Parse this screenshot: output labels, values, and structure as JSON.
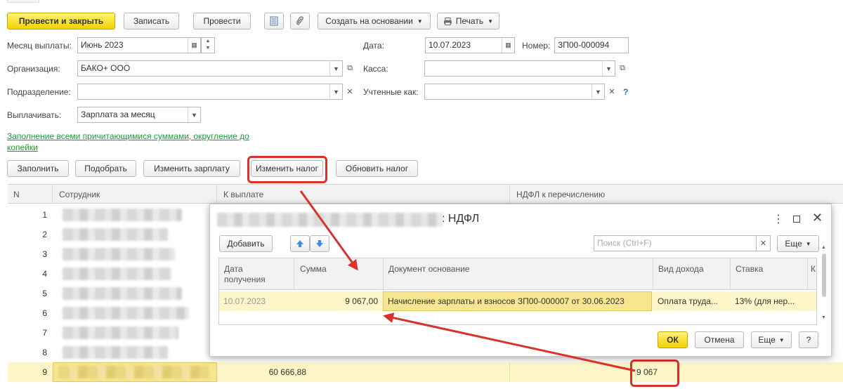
{
  "toolbar": {
    "post_close": "Провести и закрыть",
    "save": "Записать",
    "post": "Провести",
    "create_based": "Создать на основании",
    "print": "Печать"
  },
  "form": {
    "month_label": "Месяц выплаты:",
    "month_value": "Июнь 2023",
    "date_label": "Дата:",
    "date_value": "10.07.2023",
    "number_label": "Номер:",
    "number_value": "ЗП00-000094",
    "org_label": "Организация:",
    "org_value": "БАКО+ ООО",
    "cash_label": "Касса:",
    "cash_value": "",
    "dept_label": "Подразделение:",
    "dept_value": "",
    "counted_label": "Учтенные как:",
    "counted_value": "",
    "help": "?",
    "pay_label": "Выплачивать:",
    "pay_value": "Зарплата за месяц",
    "fill_link": "Заполнение всеми причитающимися суммами, округление до копейки"
  },
  "actions": {
    "fill": "Заполнить",
    "select": "Подобрать",
    "change_salary": "Изменить зарплату",
    "change_tax": "Изменить налог",
    "update_tax": "Обновить налог"
  },
  "grid": {
    "headers": {
      "n": "N",
      "employee": "Сотрудник",
      "to_pay": "К выплате",
      "ndfl": "НДФЛ к перечислению"
    },
    "rows": [
      {
        "n": "1"
      },
      {
        "n": "2"
      },
      {
        "n": "3"
      },
      {
        "n": "4"
      },
      {
        "n": "5"
      },
      {
        "n": "6"
      },
      {
        "n": "7"
      },
      {
        "n": "8"
      },
      {
        "n": "9",
        "to_pay": "60 666,88",
        "ndfl": "9 067"
      }
    ]
  },
  "dialog": {
    "title": ": НДФЛ",
    "add": "Добавить",
    "search_placeholder": "Поиск (Ctrl+F)",
    "more": "Еще",
    "headers": {
      "date": "Дата получения",
      "sum": "Сумма",
      "doc": "Документ основание",
      "income": "Вид дохода",
      "rate": "Ставка",
      "extra": "К"
    },
    "row": {
      "date": "10.07.2023",
      "sum": "9 067,00",
      "doc": "Начисление зарплаты и взносов ЗП00-000007 от 30.06.2023",
      "income": "Оплата труда...",
      "rate": "13% (для нер..."
    },
    "ok": "ОК",
    "cancel": "Отмена",
    "more2": "Еще",
    "help": "?"
  },
  "colors": {
    "accent_yellow": "#f2d200",
    "selection_row": "#fdf6c8",
    "highlight_red": "#d8322a",
    "link_green": "#1a9b3c"
  }
}
